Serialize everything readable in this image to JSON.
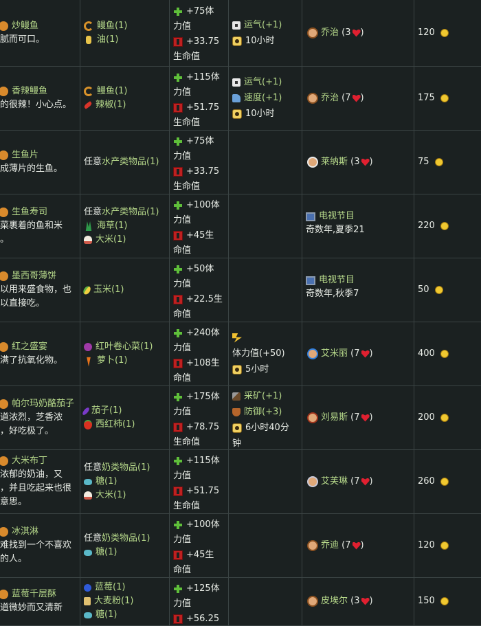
{
  "dishes": [
    {
      "name": "炒鳗鱼",
      "icon": "fried-eel-icon",
      "desc_lines": [
        "腻而可口。"
      ],
      "ingredients": [
        {
          "icon": "eel",
          "text": "鳗鱼(1)"
        },
        {
          "icon": "oil",
          "text": "油(1)"
        }
      ],
      "effects_lines": [
        {
          "icon": "plus",
          "text": "+75体"
        },
        {
          "icon": "",
          "text": "力值"
        },
        {
          "icon": "hp",
          "text": "+33.75"
        },
        {
          "icon": "",
          "text": "生命值"
        }
      ],
      "buffs_lines": [
        {
          "icon": "dice",
          "text": "运气(+1)",
          "green": true
        },
        {
          "icon": "clock",
          "text": "10小时",
          "green": false
        }
      ],
      "source": {
        "type": "npc",
        "face": "brown",
        "name": "乔治",
        "hearts": "(3",
        "icon": "george-portrait-icon"
      },
      "price": "120"
    },
    {
      "name": "香辣鳗鱼",
      "icon": "spicy-eel-icon",
      "desc_lines": [
        "的很辣！小心点。"
      ],
      "ingredients": [
        {
          "icon": "eel",
          "text": "鳗鱼(1)"
        },
        {
          "icon": "pepper",
          "text": "辣椒(1)"
        }
      ],
      "effects_lines": [
        {
          "icon": "plus",
          "text": "+115体"
        },
        {
          "icon": "",
          "text": "力值"
        },
        {
          "icon": "hp",
          "text": "+51.75"
        },
        {
          "icon": "",
          "text": "生命值"
        }
      ],
      "buffs_lines": [
        {
          "icon": "dice",
          "text": "运气(+1)",
          "green": true
        },
        {
          "icon": "boot",
          "text": "速度(+1)",
          "green": true
        },
        {
          "icon": "clock",
          "text": "10小时",
          "green": false
        }
      ],
      "source": {
        "type": "npc",
        "face": "brown",
        "name": "乔治",
        "hearts": "(7",
        "icon": "george-portrait-icon"
      },
      "price": "175"
    },
    {
      "name": "生鱼片",
      "icon": "sashimi-icon",
      "desc_lines": [
        "成薄片的生鱼。"
      ],
      "ingredients": [
        {
          "icon": "",
          "text": "任意",
          "extra": "水产类物品(1)"
        }
      ],
      "effects_lines": [
        {
          "icon": "plus",
          "text": "+75体"
        },
        {
          "icon": "",
          "text": "力值"
        },
        {
          "icon": "hp",
          "text": "+33.75"
        },
        {
          "icon": "",
          "text": "生命值"
        }
      ],
      "buffs_lines": [],
      "source": {
        "type": "npc",
        "face": "white",
        "name": "莱纳斯",
        "hearts": "(3",
        "icon": "linus-portrait-icon"
      },
      "price": "75"
    },
    {
      "name": "生鱼寿司",
      "icon": "maki-roll-icon",
      "desc_lines": [
        "菜裹着的鱼和米",
        "。"
      ],
      "ingredients": [
        {
          "icon": "",
          "text": "任意",
          "extra": "水产类物品(1)"
        },
        {
          "icon": "seaweed",
          "text": "海草(1)"
        },
        {
          "icon": "rice",
          "text": "大米(1)"
        }
      ],
      "effects_lines": [
        {
          "icon": "plus",
          "text": "+100体"
        },
        {
          "icon": "",
          "text": "力值"
        },
        {
          "icon": "hp",
          "text": "+45生"
        },
        {
          "icon": "",
          "text": "命值"
        }
      ],
      "buffs_lines": [],
      "source": {
        "type": "tv",
        "title": "电视节目",
        "sub": "奇数年,夏季21"
      },
      "price": "220"
    },
    {
      "name": "墨西哥薄饼",
      "icon": "tortilla-icon",
      "desc_lines": [
        "以用来盛食物，也",
        "以直接吃。"
      ],
      "ingredients": [
        {
          "icon": "corn",
          "text": "玉米(1)"
        }
      ],
      "effects_lines": [
        {
          "icon": "plus",
          "text": "+50体"
        },
        {
          "icon": "",
          "text": "力值"
        },
        {
          "icon": "hp",
          "text": "+22.5生"
        },
        {
          "icon": "",
          "text": "命值"
        }
      ],
      "buffs_lines": [],
      "source": {
        "type": "tv",
        "title": "电视节目",
        "sub": "奇数年,秋季7"
      },
      "price": "50"
    },
    {
      "name": "红之盛宴",
      "icon": "red-plate-icon",
      "desc_lines": [
        "满了抗氧化物。"
      ],
      "ingredients": [
        {
          "icon": "cabbage",
          "text": "红叶卷心菜(1)"
        },
        {
          "icon": "carrot",
          "text": "萝卜(1)"
        }
      ],
      "effects_lines": [
        {
          "icon": "plus",
          "text": "+240体"
        },
        {
          "icon": "",
          "text": "力值"
        },
        {
          "icon": "hp",
          "text": "+108生"
        },
        {
          "icon": "",
          "text": "命值"
        }
      ],
      "buffs_lines": [
        {
          "icon": "energy",
          "text": "",
          "green": false
        },
        {
          "icon": "",
          "text": "体力值(+50)",
          "green": false
        },
        {
          "icon": "clock",
          "text": "5小时",
          "green": false
        }
      ],
      "source": {
        "type": "npc",
        "face": "blue",
        "name": "艾米丽",
        "hearts": "(7",
        "icon": "emily-portrait-icon"
      },
      "price": "400"
    },
    {
      "name": "帕尔玛奶酪茄子",
      "icon": "eggplant-parmesan-icon",
      "desc_lines": [
        "道浓烈，芝香浓",
        "，好吃极了。"
      ],
      "ingredients": [
        {
          "icon": "eggplant",
          "text": "茄子(1)"
        },
        {
          "icon": "tomato",
          "text": "西红柿(1)"
        }
      ],
      "effects_lines": [
        {
          "icon": "plus",
          "text": "+175体"
        },
        {
          "icon": "",
          "text": "力值"
        },
        {
          "icon": "hp",
          "text": "+78.75"
        },
        {
          "icon": "",
          "text": "生命值"
        }
      ],
      "buffs_lines": [
        {
          "icon": "pick",
          "text": "采矿(+1)",
          "green": true
        },
        {
          "icon": "shield",
          "text": "防御(+3)",
          "green": true
        },
        {
          "icon": "clock",
          "text": "6小时40分",
          "green": false
        },
        {
          "icon": "",
          "text": "钟",
          "green": false
        }
      ],
      "source": {
        "type": "npc",
        "face": "red",
        "name": "刘易斯",
        "hearts": "(7",
        "icon": "lewis-portrait-icon"
      },
      "price": "200"
    },
    {
      "name": "大米布丁",
      "icon": "rice-pudding-icon",
      "desc_lines": [
        "浓郁的奶油，又",
        "，并且吃起来也很",
        "意思。"
      ],
      "ingredients": [
        {
          "icon": "",
          "text": "任意",
          "extra": "奶类物品(1)"
        },
        {
          "icon": "sugar",
          "text": "糖(1)"
        },
        {
          "icon": "rice",
          "text": "大米(1)"
        }
      ],
      "effects_lines": [
        {
          "icon": "plus",
          "text": "+115体"
        },
        {
          "icon": "",
          "text": "力值"
        },
        {
          "icon": "hp",
          "text": "+51.75"
        },
        {
          "icon": "",
          "text": "生命值"
        }
      ],
      "buffs_lines": [],
      "source": {
        "type": "npc",
        "face": "silver",
        "name": "艾芙琳",
        "hearts": "(7",
        "icon": "evelyn-portrait-icon"
      },
      "price": "260"
    },
    {
      "name": "冰淇淋",
      "icon": "ice-cream-icon",
      "desc_lines": [
        "难找到一个不喜欢",
        "的人。"
      ],
      "ingredients": [
        {
          "icon": "",
          "text": "任意",
          "extra": "奶类物品(1)"
        },
        {
          "icon": "sugar",
          "text": "糖(1)"
        }
      ],
      "effects_lines": [
        {
          "icon": "plus",
          "text": "+100体"
        },
        {
          "icon": "",
          "text": "力值"
        },
        {
          "icon": "hp",
          "text": "+45生"
        },
        {
          "icon": "",
          "text": "命值"
        }
      ],
      "buffs_lines": [],
      "source": {
        "type": "npc",
        "face": "brown",
        "name": "乔迪",
        "hearts": "(7",
        "icon": "jodi-portrait-icon"
      },
      "price": "120"
    },
    {
      "name": "蓝莓千层酥",
      "icon": "blueberry-tart-icon",
      "desc_lines": [
        "道微妙而又清新"
      ],
      "ingredients": [
        {
          "icon": "blueberry",
          "text": "蓝莓(1)"
        },
        {
          "icon": "flour",
          "text": "大麦粉(1)"
        },
        {
          "icon": "sugar",
          "text": "糖(1)"
        }
      ],
      "effects_lines": [
        {
          "icon": "plus",
          "text": "+125体"
        },
        {
          "icon": "",
          "text": "力值"
        },
        {
          "icon": "hp",
          "text": "+56.25"
        }
      ],
      "buffs_lines": [],
      "source": {
        "type": "npc",
        "face": "brown",
        "name": "皮埃尔",
        "hearts": "(3",
        "icon": "pierre-portrait-icon"
      },
      "price": "150"
    }
  ]
}
